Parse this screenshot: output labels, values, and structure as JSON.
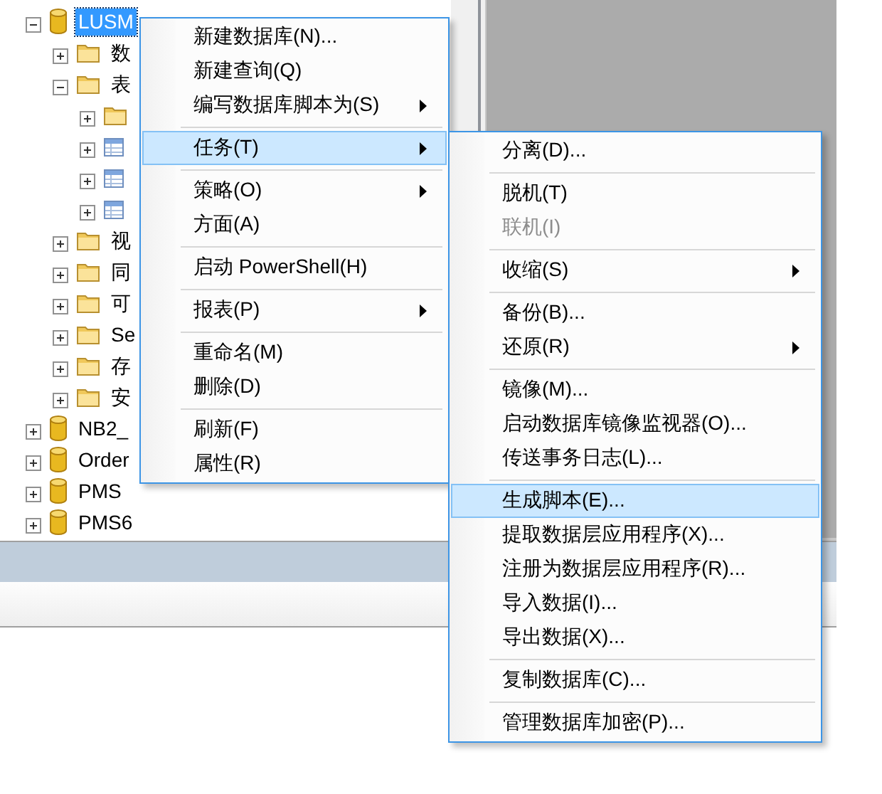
{
  "tree": [
    {
      "label": "LUSM",
      "kind": "database",
      "expanded": true,
      "selected": true,
      "children": [
        {
          "label": "数",
          "kind": "folder",
          "expanded": false,
          "selected": false
        },
        {
          "label": "表",
          "kind": "folder",
          "expanded": true,
          "selected": false,
          "children": [
            {
              "kind": "folder",
              "expanded": false
            },
            {
              "kind": "table",
              "expanded": false
            },
            {
              "kind": "table",
              "expanded": false
            },
            {
              "kind": "table",
              "expanded": false
            }
          ]
        },
        {
          "label": "视",
          "kind": "folder",
          "expanded": false,
          "selected": false
        },
        {
          "label": "同",
          "kind": "folder",
          "expanded": false,
          "selected": false
        },
        {
          "label": "可",
          "kind": "folder",
          "expanded": false,
          "selected": false
        },
        {
          "label": "Se",
          "kind": "folder",
          "expanded": false,
          "selected": false
        },
        {
          "label": "存",
          "kind": "folder",
          "expanded": false,
          "selected": false
        },
        {
          "label": "安",
          "kind": "folder",
          "expanded": false,
          "selected": false
        }
      ]
    },
    {
      "label": "NB2_",
      "kind": "database",
      "expanded": false,
      "selected": false
    },
    {
      "label": "Order",
      "kind": "database",
      "expanded": false,
      "selected": false
    },
    {
      "label": "PMS",
      "kind": "database",
      "expanded": false,
      "selected": false
    },
    {
      "label": "PMS6",
      "kind": "database",
      "expanded": false,
      "selected": false
    }
  ],
  "context_menu": [
    {
      "kind": "item",
      "label": "新建数据库(N)...",
      "submenu": false,
      "selected": false,
      "disabled": false
    },
    {
      "kind": "item",
      "label": "新建查询(Q)",
      "submenu": false,
      "selected": false,
      "disabled": false
    },
    {
      "kind": "item",
      "label": "编写数据库脚本为(S)",
      "submenu": true,
      "selected": false,
      "disabled": false
    },
    {
      "kind": "separator"
    },
    {
      "kind": "item",
      "label": "任务(T)",
      "submenu": true,
      "selected": true,
      "disabled": false
    },
    {
      "kind": "separator"
    },
    {
      "kind": "item",
      "label": "策略(O)",
      "submenu": true,
      "selected": false,
      "disabled": false
    },
    {
      "kind": "item",
      "label": "方面(A)",
      "submenu": false,
      "selected": false,
      "disabled": false
    },
    {
      "kind": "separator"
    },
    {
      "kind": "item",
      "label": "启动 PowerShell(H)",
      "submenu": false,
      "selected": false,
      "disabled": false
    },
    {
      "kind": "separator"
    },
    {
      "kind": "item",
      "label": "报表(P)",
      "submenu": true,
      "selected": false,
      "disabled": false
    },
    {
      "kind": "separator"
    },
    {
      "kind": "item",
      "label": "重命名(M)",
      "submenu": false,
      "selected": false,
      "disabled": false
    },
    {
      "kind": "item",
      "label": "删除(D)",
      "submenu": false,
      "selected": false,
      "disabled": false
    },
    {
      "kind": "separator"
    },
    {
      "kind": "item",
      "label": "刷新(F)",
      "submenu": false,
      "selected": false,
      "disabled": false
    },
    {
      "kind": "item",
      "label": "属性(R)",
      "submenu": false,
      "selected": false,
      "disabled": false
    }
  ],
  "tasks_submenu": [
    {
      "kind": "item",
      "label": "分离(D)...",
      "submenu": false,
      "selected": false,
      "disabled": false
    },
    {
      "kind": "separator"
    },
    {
      "kind": "item",
      "label": "脱机(T)",
      "submenu": false,
      "selected": false,
      "disabled": false
    },
    {
      "kind": "item",
      "label": "联机(I)",
      "submenu": false,
      "selected": false,
      "disabled": true
    },
    {
      "kind": "separator"
    },
    {
      "kind": "item",
      "label": "收缩(S)",
      "submenu": true,
      "selected": false,
      "disabled": false
    },
    {
      "kind": "separator"
    },
    {
      "kind": "item",
      "label": "备份(B)...",
      "submenu": false,
      "selected": false,
      "disabled": false
    },
    {
      "kind": "item",
      "label": "还原(R)",
      "submenu": true,
      "selected": false,
      "disabled": false
    },
    {
      "kind": "separator"
    },
    {
      "kind": "item",
      "label": "镜像(M)...",
      "submenu": false,
      "selected": false,
      "disabled": false
    },
    {
      "kind": "item",
      "label": "启动数据库镜像监视器(O)...",
      "submenu": false,
      "selected": false,
      "disabled": false
    },
    {
      "kind": "item",
      "label": "传送事务日志(L)...",
      "submenu": false,
      "selected": false,
      "disabled": false
    },
    {
      "kind": "separator"
    },
    {
      "kind": "item",
      "label": "生成脚本(E)...",
      "submenu": false,
      "selected": true,
      "disabled": false
    },
    {
      "kind": "item",
      "label": "提取数据层应用程序(X)...",
      "submenu": false,
      "selected": false,
      "disabled": false
    },
    {
      "kind": "item",
      "label": "注册为数据层应用程序(R)...",
      "submenu": false,
      "selected": false,
      "disabled": false
    },
    {
      "kind": "item",
      "label": "导入数据(I)...",
      "submenu": false,
      "selected": false,
      "disabled": false
    },
    {
      "kind": "item",
      "label": "导出数据(X)...",
      "submenu": false,
      "selected": false,
      "disabled": false
    },
    {
      "kind": "separator"
    },
    {
      "kind": "item",
      "label": "复制数据库(C)...",
      "submenu": false,
      "selected": false,
      "disabled": false
    },
    {
      "kind": "separator"
    },
    {
      "kind": "item",
      "label": "管理数据库加密(P)...",
      "submenu": false,
      "selected": false,
      "disabled": false
    }
  ]
}
